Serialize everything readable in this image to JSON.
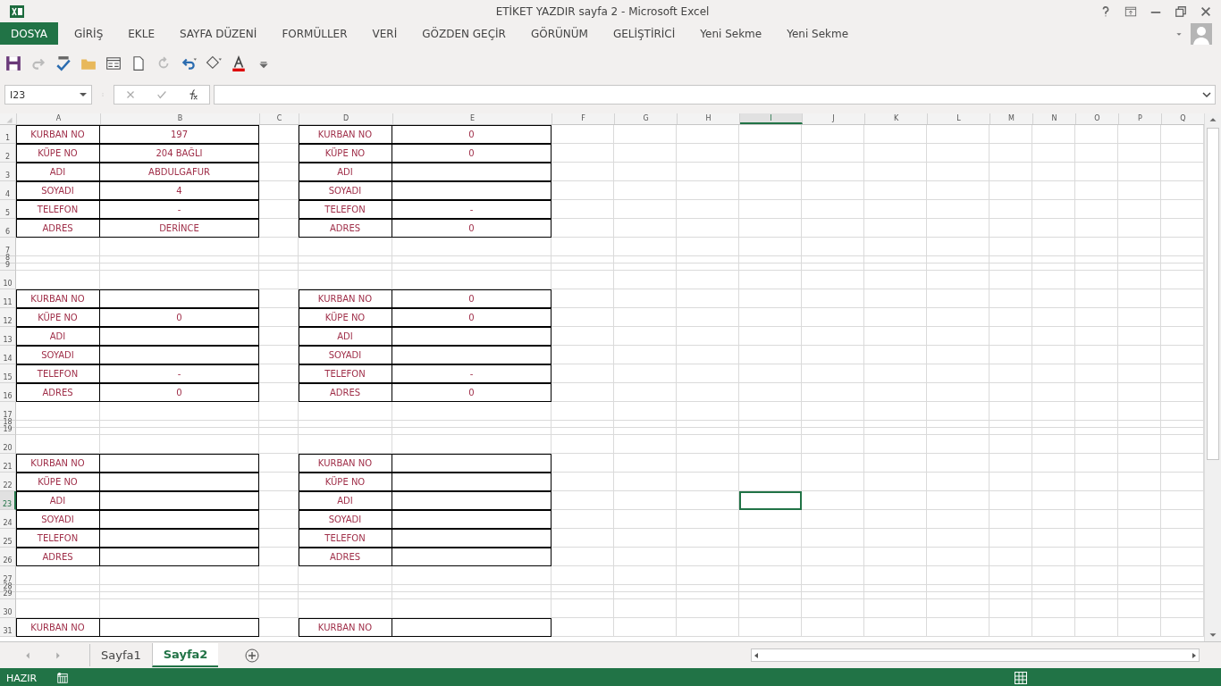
{
  "window": {
    "title": "ETİKET YAZDIR sayfa 2 - Microsoft Excel"
  },
  "ribbon_tabs": [
    {
      "label": "DOSYA",
      "kind": "file"
    },
    {
      "label": "GİRİŞ",
      "kind": "tab"
    },
    {
      "label": "EKLE",
      "kind": "tab"
    },
    {
      "label": "SAYFA DÜZENİ",
      "kind": "tab"
    },
    {
      "label": "FORMÜLLER",
      "kind": "tab"
    },
    {
      "label": "VERİ",
      "kind": "tab"
    },
    {
      "label": "GÖZDEN GEÇİR",
      "kind": "tab"
    },
    {
      "label": "GÖRÜNÜM",
      "kind": "tab"
    },
    {
      "label": "GELİŞTİRİCİ",
      "kind": "tab"
    },
    {
      "label": "Yeni Sekme",
      "kind": "tab"
    },
    {
      "label": "Yeni Sekme",
      "kind": "tab"
    }
  ],
  "name_box": "I23",
  "columns": [
    {
      "label": "A",
      "selected": false
    },
    {
      "label": "B",
      "selected": false
    },
    {
      "label": "C",
      "selected": false
    },
    {
      "label": "D",
      "selected": false
    },
    {
      "label": "E",
      "selected": false
    },
    {
      "label": "F",
      "selected": false
    },
    {
      "label": "G",
      "selected": false
    },
    {
      "label": "H",
      "selected": false
    },
    {
      "label": "I",
      "selected": true
    },
    {
      "label": "J",
      "selected": false
    },
    {
      "label": "K",
      "selected": false
    },
    {
      "label": "L",
      "selected": false
    },
    {
      "label": "M",
      "selected": false
    },
    {
      "label": "N",
      "selected": false
    },
    {
      "label": "O",
      "selected": false
    },
    {
      "label": "P",
      "selected": false
    },
    {
      "label": "Q",
      "selected": false
    }
  ],
  "rows": [
    {
      "number": "1",
      "boxed": true,
      "short": false,
      "selected": false,
      "a": "KURBAN NO",
      "b": "197",
      "d": "KURBAN NO",
      "e": "0"
    },
    {
      "number": "2",
      "boxed": true,
      "short": false,
      "selected": false,
      "a": "KÜPE NO",
      "b": "204 BAĞLI",
      "d": "KÜPE NO",
      "e": "0"
    },
    {
      "number": "3",
      "boxed": true,
      "short": false,
      "selected": false,
      "a": "ADI",
      "b": "ABDULGAFUR",
      "d": "ADI"
    },
    {
      "number": "4",
      "boxed": true,
      "short": false,
      "selected": false,
      "a": "SOYADI",
      "b": "4",
      "d": "SOYADI"
    },
    {
      "number": "5",
      "boxed": true,
      "short": false,
      "selected": false,
      "a": "TELEFON",
      "b": "-",
      "d": "TELEFON",
      "e": "-"
    },
    {
      "number": "6",
      "boxed": true,
      "short": false,
      "selected": false,
      "a": "ADRES",
      "b": "DERİNCE",
      "d": "ADRES",
      "e": "0"
    },
    {
      "number": "7",
      "boxed": false,
      "short": false,
      "selected": false
    },
    {
      "number": "8",
      "boxed": false,
      "short": true,
      "selected": false
    },
    {
      "number": "9",
      "boxed": false,
      "short": true,
      "selected": false
    },
    {
      "number": "10",
      "boxed": false,
      "short": false,
      "selected": false
    },
    {
      "number": "11",
      "boxed": true,
      "short": false,
      "selected": false,
      "a": "KURBAN NO",
      "d": "KURBAN NO",
      "e": "0"
    },
    {
      "number": "12",
      "boxed": true,
      "short": false,
      "selected": false,
      "a": "KÜPE NO",
      "b": "0",
      "d": "KÜPE NO",
      "e": "0"
    },
    {
      "number": "13",
      "boxed": true,
      "short": false,
      "selected": false,
      "a": "ADI",
      "d": "ADI"
    },
    {
      "number": "14",
      "boxed": true,
      "short": false,
      "selected": false,
      "a": "SOYADI",
      "d": "SOYADI"
    },
    {
      "number": "15",
      "boxed": true,
      "short": false,
      "selected": false,
      "a": "TELEFON",
      "b": "-",
      "d": "TELEFON",
      "e": "-"
    },
    {
      "number": "16",
      "boxed": true,
      "short": false,
      "selected": false,
      "a": "ADRES",
      "b": "0",
      "d": "ADRES",
      "e": "0"
    },
    {
      "number": "17",
      "boxed": false,
      "short": false,
      "selected": false
    },
    {
      "number": "18",
      "boxed": false,
      "short": true,
      "selected": false
    },
    {
      "number": "19",
      "boxed": false,
      "short": true,
      "selected": false
    },
    {
      "number": "20",
      "boxed": false,
      "short": false,
      "selected": false
    },
    {
      "number": "21",
      "boxed": true,
      "short": false,
      "selected": false,
      "a": "KURBAN NO",
      "d": "KURBAN NO"
    },
    {
      "number": "22",
      "boxed": true,
      "short": false,
      "selected": false,
      "a": "KÜPE NO",
      "d": "KÜPE NO"
    },
    {
      "number": "23",
      "boxed": true,
      "short": false,
      "selected": true,
      "a": "ADI",
      "d": "ADI"
    },
    {
      "number": "24",
      "boxed": true,
      "short": false,
      "selected": false,
      "a": "SOYADI",
      "d": "SOYADI"
    },
    {
      "number": "25",
      "boxed": true,
      "short": false,
      "selected": false,
      "a": "TELEFON",
      "d": "TELEFON"
    },
    {
      "number": "26",
      "boxed": true,
      "short": false,
      "selected": false,
      "a": "ADRES",
      "d": "ADRES"
    },
    {
      "number": "27",
      "boxed": false,
      "short": false,
      "selected": false
    },
    {
      "number": "28",
      "boxed": false,
      "short": true,
      "selected": false
    },
    {
      "number": "29",
      "boxed": false,
      "short": true,
      "selected": false
    },
    {
      "number": "30",
      "boxed": false,
      "short": false,
      "selected": false
    },
    {
      "number": "31",
      "boxed": true,
      "short": false,
      "selected": false,
      "a": "KURBAN NO",
      "d": "KURBAN NO"
    }
  ],
  "sheet_tabs": [
    {
      "label": "Sayfa1",
      "selected": false
    },
    {
      "label": "Sayfa2",
      "selected": true
    }
  ],
  "status_bar": {
    "mode": "HAZIR"
  }
}
